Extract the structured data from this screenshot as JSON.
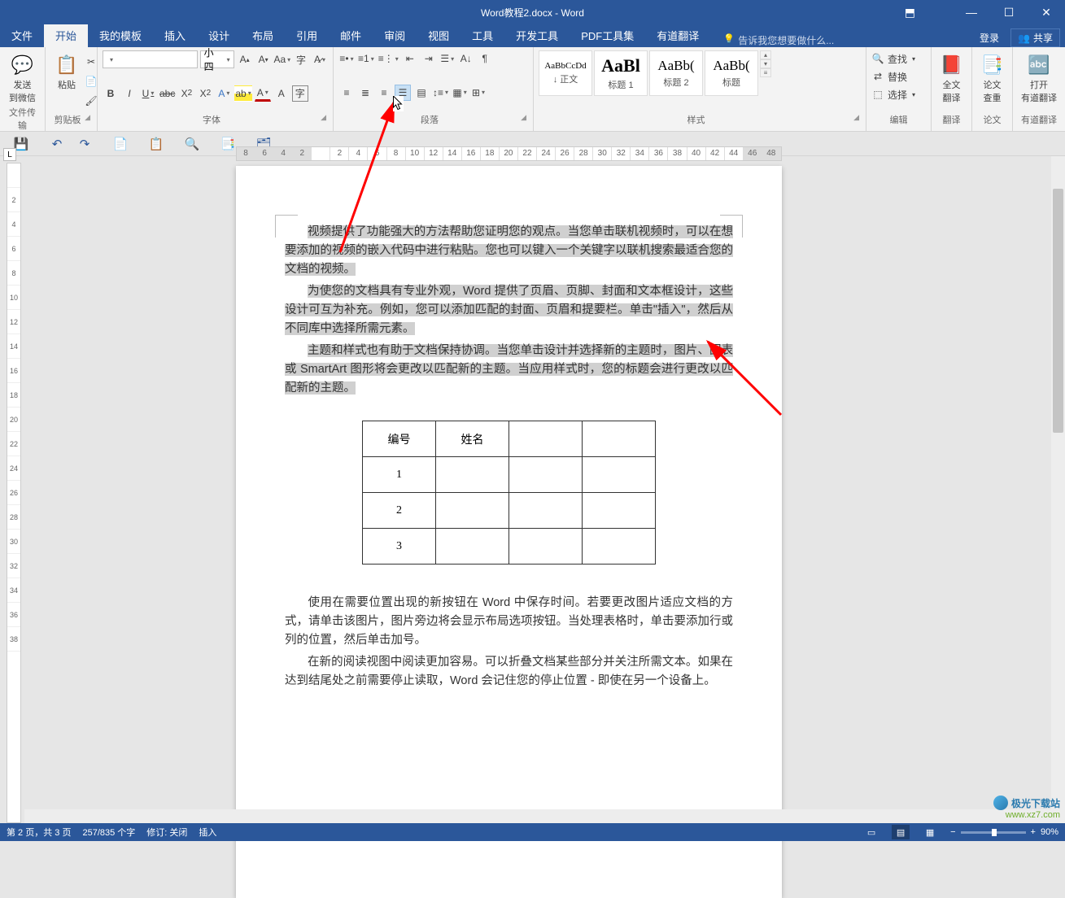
{
  "app": {
    "title": "Word教程2.docx - Word"
  },
  "window_controls": {
    "rib_toggle": "⬒",
    "min": "—",
    "max": "☐",
    "close": "✕"
  },
  "menu": {
    "items": [
      "文件",
      "开始",
      "我的模板",
      "插入",
      "设计",
      "布局",
      "引用",
      "邮件",
      "审阅",
      "视图",
      "工具",
      "开发工具",
      "PDF工具集",
      "有道翻译"
    ],
    "active": 1,
    "tell_me": "告诉我您想要做什么...",
    "login": "登录",
    "share": "共享"
  },
  "ribbon": {
    "wechat": {
      "label1": "发送",
      "label2": "到微信",
      "group": "文件传输"
    },
    "clipboard": {
      "paste": "粘贴",
      "group": "剪贴板"
    },
    "font": {
      "name_placeholder": "",
      "size": "小四",
      "group": "字体"
    },
    "paragraph": {
      "group": "段落"
    },
    "styles": {
      "items": [
        {
          "preview": "AaBbCcDd",
          "name": "↓ 正文",
          "size": "11px"
        },
        {
          "preview": "AaBl",
          "name": "标题 1",
          "size": "22px"
        },
        {
          "preview": "AaBb(",
          "name": "标题 2",
          "size": "17px"
        },
        {
          "preview": "AaBb(",
          "name": "标题",
          "size": "17px"
        }
      ],
      "group": "样式"
    },
    "editing": {
      "find": "查找",
      "replace": "替换",
      "select": "选择",
      "group": "编辑"
    },
    "translate_all": {
      "l1": "全文",
      "l2": "翻译",
      "group": "翻译"
    },
    "thesis": {
      "l1": "论文",
      "l2": "查重",
      "group": "论文"
    },
    "open_yd": {
      "l1": "打开",
      "l2": "有道翻译",
      "group": "有道翻译"
    }
  },
  "qat": [
    "💾",
    "↶",
    "↷",
    "📄",
    "📋",
    "🔍",
    "📑",
    "🗂"
  ],
  "hruler": [
    "8",
    "6",
    "4",
    "2",
    "",
    "2",
    "4",
    "6",
    "8",
    "10",
    "12",
    "14",
    "16",
    "18",
    "20",
    "22",
    "24",
    "26",
    "28",
    "30",
    "32",
    "34",
    "36",
    "38",
    "40",
    "42",
    "44",
    "46",
    "48"
  ],
  "vruler": [
    "",
    "2",
    "4",
    "6",
    "8",
    "10",
    "12",
    "14",
    "16",
    "18",
    "20",
    "22",
    "24",
    "26",
    "28",
    "30",
    "32",
    "34",
    "36",
    "38"
  ],
  "document": {
    "p1": "视频提供了功能强大的方法帮助您证明您的观点。当您单击联机视频时，可以在想要添加的视频的嵌入代码中进行粘贴。您也可以键入一个关键字以联机搜索最适合您的文档的视频。",
    "p2a": "为使您的文档具有专业外观，Word",
    "p2b": " 提供了页眉、页脚、封面和文本框设计，这些设计可互为补充。例如，您可以添加匹配的封面、页眉和提要栏。单击\"插入\"，然后从不同库中选择所需元素。",
    "p3": "主题和样式也有助于文档保持协调。当您单击设计并选择新的主题时，图片、图表或 SmartArt 图形将会更改以匹配新的主题。当应用样式时，您的标题会进行更改以匹配新的主题。",
    "table": {
      "headers": [
        "编号",
        "姓名",
        "",
        ""
      ],
      "rows": [
        [
          "1",
          "",
          "",
          ""
        ],
        [
          "2",
          "",
          "",
          ""
        ],
        [
          "3",
          "",
          "",
          ""
        ]
      ]
    },
    "p4": "使用在需要位置出现的新按钮在 Word 中保存时间。若要更改图片适应文档的方式，请单击该图片，图片旁边将会显示布局选项按钮。当处理表格时，单击要添加行或列的位置，然后单击加号。",
    "p5": "在新的阅读视图中阅读更加容易。可以折叠文档某些部分并关注所需文本。如果在达到结尾处之前需要停止读取，Word 会记住您的停止位置 - 即使在另一个设备上。"
  },
  "status": {
    "page": "第 2 页，共 3 页",
    "words": "257/835 个字",
    "track": "修订: 关闭",
    "insert": "插入",
    "zoom": "90%"
  },
  "watermark": {
    "name": "极光下载站",
    "url": "www.xz7.com"
  }
}
